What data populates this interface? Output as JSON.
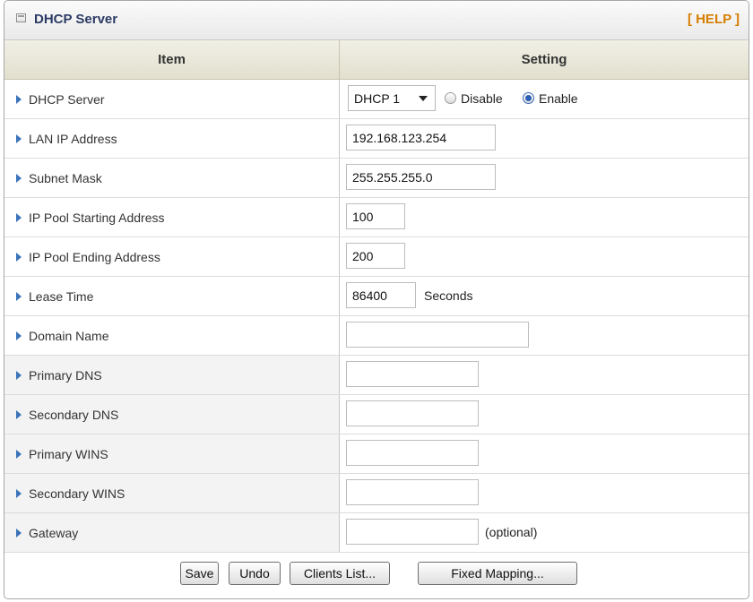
{
  "header": {
    "title": "DHCP Server",
    "help": "[ HELP ]"
  },
  "columns": {
    "item": "Item",
    "setting": "Setting"
  },
  "rows": [
    {
      "label": "DHCP Server",
      "select": "DHCP 1",
      "radio_disable": "Disable",
      "radio_enable": "Enable",
      "selected": "Enable"
    },
    {
      "label": "LAN IP Address",
      "value": "192.168.123.254"
    },
    {
      "label": "Subnet Mask",
      "value": "255.255.255.0"
    },
    {
      "label": "IP Pool Starting Address",
      "value": "100"
    },
    {
      "label": "IP Pool Ending Address",
      "value": "200"
    },
    {
      "label": "Lease Time",
      "value": "86400",
      "unit": "Seconds"
    },
    {
      "label": "Domain Name",
      "value": ""
    },
    {
      "label": "Primary DNS",
      "value": ""
    },
    {
      "label": "Secondary DNS",
      "value": ""
    },
    {
      "label": "Primary WINS",
      "value": ""
    },
    {
      "label": "Secondary WINS",
      "value": ""
    },
    {
      "label": "Gateway",
      "value": "",
      "note": "(optional)"
    }
  ],
  "buttons": {
    "save": "Save",
    "undo": "Undo",
    "clients": "Clients List...",
    "fixed": "Fixed Mapping..."
  },
  "colors": {
    "title": "#2c3a64",
    "help": "#d77d00",
    "arrow": "#3b73b9",
    "header_bg": "#e2dfcd"
  }
}
